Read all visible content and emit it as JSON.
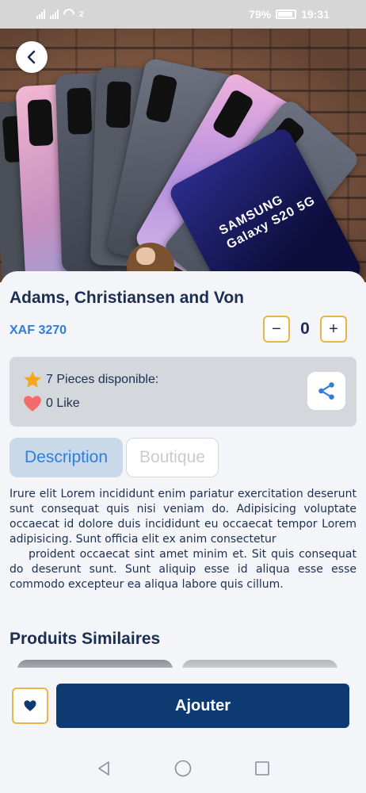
{
  "status_bar": {
    "network_badge": "2",
    "battery": "79%",
    "time": "19:31"
  },
  "hero": {
    "phone_brand": "SAMSUNG",
    "phone_model": "Galaxy S20 5G"
  },
  "product": {
    "title": "Adams, Christiansen and Von",
    "price": "XAF 3270",
    "quantity": "0",
    "quantity_minus": "−",
    "quantity_plus": "+",
    "stock": "7 Pieces disponible:",
    "likes": "0 Like"
  },
  "tabs": [
    {
      "label": "Description",
      "active": true
    },
    {
      "label": "Boutique",
      "active": false
    }
  ],
  "description": "Irure elit Lorem incididunt enim pariatur exercitation deserunt sunt consequat quis nisi veniam do. Adipisicing voluptate occaecat id dolore duis incididunt eu occaecat tempor Lorem adipisicing. Sunt officia elit ex anim consectetur\n    proident occaecat sint amet minim et. Sit quis consequat do deserunt sunt. Sunt aliquip esse id aliqua esse esse commodo excepteur ea aliqua labore quis cillum.",
  "similar": {
    "title": "Produits Similaires"
  },
  "actions": {
    "add_label": "Ajouter"
  },
  "colors": {
    "primary": "#0e3a72",
    "accent": "#e7b54a",
    "link": "#2f7ed8",
    "star": "#f4a61c",
    "heart": "#f36b6b"
  },
  "icons": [
    "back-arrow-icon",
    "star-icon",
    "heart-icon",
    "share-icon",
    "favorite-heart-icon",
    "nav-back-icon",
    "nav-home-icon",
    "nav-recents-icon"
  ]
}
